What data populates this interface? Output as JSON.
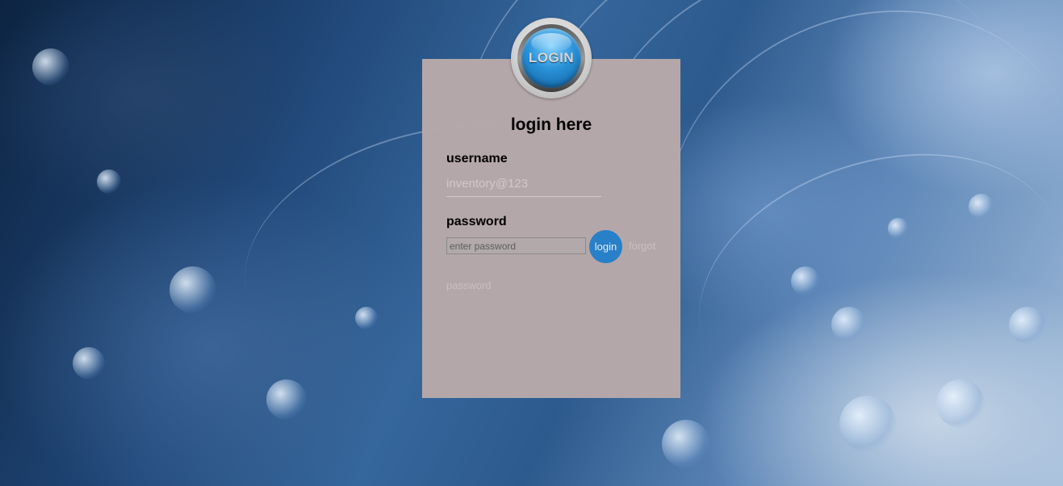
{
  "logo": {
    "text": "LOGIN"
  },
  "form": {
    "title": "login here",
    "username_label": "username",
    "username_placeholder": "inventory@123",
    "password_label": "password",
    "password_placeholder": "enter password",
    "login_button_label": "login",
    "forgot_label_line1": "forgot",
    "forgot_label_line2": "password"
  },
  "colors": {
    "panel": "#b7a8aa",
    "login_button": "#2780c8",
    "logo_blue": "#2a92d8"
  },
  "icons": {
    "logo": "login-badge-icon"
  }
}
